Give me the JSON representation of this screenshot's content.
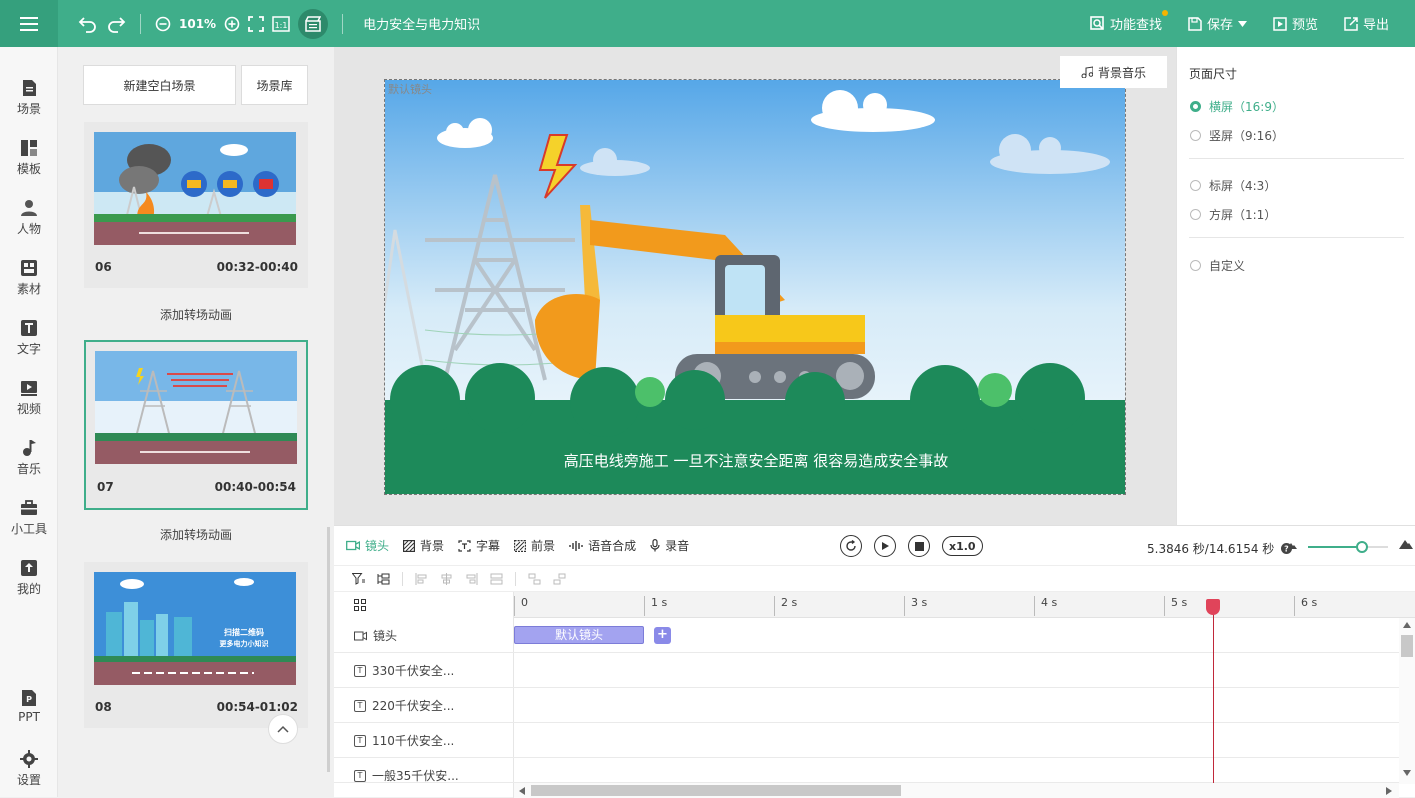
{
  "header": {
    "zoom": "101%",
    "doc_title": "电力安全与电力知识",
    "actions": [
      {
        "label": "功能查找",
        "icon": "search-doc-icon"
      },
      {
        "label": "保存",
        "icon": "save-icon"
      },
      {
        "label": "预览",
        "icon": "preview-icon"
      },
      {
        "label": "导出",
        "icon": "export-icon"
      }
    ]
  },
  "nav": [
    {
      "label": "场景",
      "icon": "scene-icon"
    },
    {
      "label": "模板",
      "icon": "template-icon"
    },
    {
      "label": "人物",
      "icon": "person-icon"
    },
    {
      "label": "素材",
      "icon": "material-icon"
    },
    {
      "label": "文字",
      "icon": "text-icon"
    },
    {
      "label": "视频",
      "icon": "video-icon"
    },
    {
      "label": "音乐",
      "icon": "music-icon"
    },
    {
      "label": "小工具",
      "icon": "toolbox-icon"
    },
    {
      "label": "我的",
      "icon": "upload-icon"
    },
    {
      "label": "PPT",
      "icon": "ppt-icon"
    },
    {
      "label": "设置",
      "icon": "settings-icon"
    }
  ],
  "scene_panel": {
    "new_blank": "新建空白场景",
    "library": "场景库",
    "add_transition": "添加转场动画",
    "scenes": [
      {
        "num": "06",
        "time": "00:32-00:40"
      },
      {
        "num": "07",
        "time": "00:40-00:54"
      },
      {
        "num": "08",
        "time": "00:54-01:02"
      }
    ],
    "thumb_texts": {
      "s08_title1": "扫描二维码",
      "s08_title2": "更多电力小知识"
    }
  },
  "canvas": {
    "background_music": "背景音乐",
    "default_lens": "默认镜头",
    "caption": "高压电线旁施工 一旦不注意安全距离 很容易造成安全事故"
  },
  "page_size": {
    "title": "页面尺寸",
    "options": [
      {
        "label": "横屏（16:9）",
        "selected": true
      },
      {
        "label": "竖屏（9:16）",
        "selected": false
      },
      {
        "label": "标屏（4:3）",
        "selected": false
      },
      {
        "label": "方屏（1:1）",
        "selected": false
      },
      {
        "label": "自定义",
        "selected": false
      }
    ]
  },
  "timeline": {
    "tabs": [
      {
        "label": "镜头",
        "icon": "camera-icon",
        "active": true
      },
      {
        "label": "背景",
        "icon": "background-icon",
        "active": false
      },
      {
        "label": "字幕",
        "icon": "subtitle-icon",
        "active": false
      },
      {
        "label": "前景",
        "icon": "foreground-icon",
        "active": false
      },
      {
        "label": "语音合成",
        "icon": "voice-synth-icon",
        "active": false
      },
      {
        "label": "录音",
        "icon": "mic-icon",
        "active": false
      }
    ],
    "speed": "x1.0",
    "time_display": "5.3846 秒/14.6154 秒",
    "zoom_level": 0.7,
    "ruler": [
      "0",
      "1 s",
      "2 s",
      "3 s",
      "4 s",
      "5 s",
      "6 s"
    ],
    "tracks": [
      {
        "label": "镜头",
        "type": "camera"
      },
      {
        "label": "330千伏安全...",
        "type": "text"
      },
      {
        "label": "220千伏安全...",
        "type": "text"
      },
      {
        "label": "110千伏安全...",
        "type": "text"
      },
      {
        "label": "一般35千伏安...",
        "type": "text"
      }
    ],
    "lens_block": "默认镜头",
    "playhead_seconds": 5.3846,
    "colors": {
      "accent": "#3fae8a",
      "playhead": "#c0283a",
      "lens": "#a3a3f0"
    }
  }
}
